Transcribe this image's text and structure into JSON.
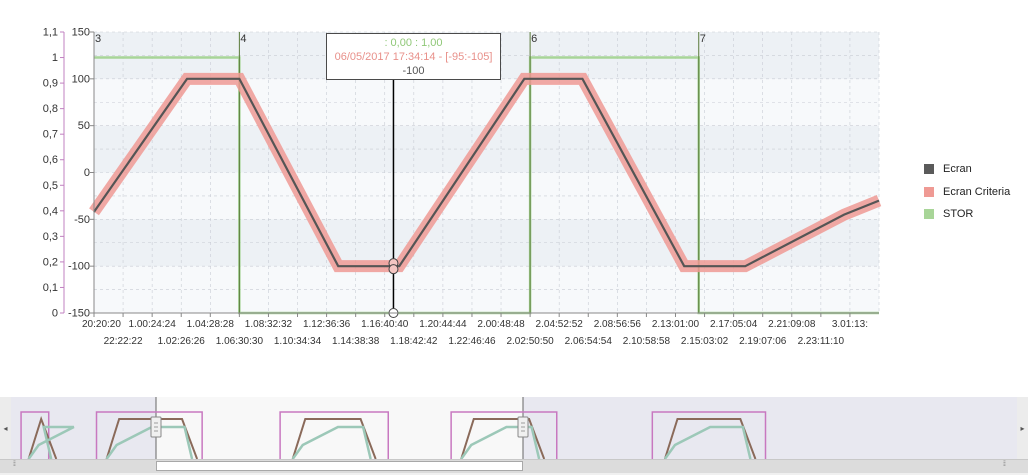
{
  "chart_data": {
    "type": "line",
    "left_axis_ticks": [
      "0",
      "0,1",
      "0,2",
      "0,3",
      "0,4",
      "0,5",
      "0,6",
      "0,7",
      "0,8",
      "0,9",
      "1",
      "1,1"
    ],
    "left_axis_range": [
      0,
      1.1
    ],
    "right_axis_ticks": [
      "-150",
      "-100",
      "-50",
      "0",
      "50",
      "100",
      "150"
    ],
    "right_axis_range": [
      -150,
      150
    ],
    "x_labels_row1": [
      "20:20:20",
      "1.00:24:24",
      "1.04:28:28",
      "1.08:32:32",
      "1.12:36:36",
      "1.16:40:40",
      "1.20:44:44",
      "2.00:48:48",
      "2.04:52:52",
      "2.08:56:56",
      "2.13:01:00",
      "2.17:05:04",
      "2.21:09:08",
      "3.01:13:"
    ],
    "x_labels_row2": [
      "22:22:22",
      "1.02:26:26",
      "1.06:30:30",
      "1.10:34:34",
      "1.14:38:38",
      "1.18:42:42",
      "1.22:46:46",
      "2.02:50:50",
      "2.06:54:54",
      "2.10:58:58",
      "2.15:03:02",
      "2.19:07:06",
      "2.23:11:10"
    ],
    "x_range": [
      0,
      27
    ],
    "series": [
      {
        "name": "Ecran",
        "color": "#555555",
        "axis": "right",
        "x": [
          0,
          3.2,
          5.0,
          8.4,
          10.5,
          14.8,
          16.8,
          20.3,
          22.4,
          25.8,
          27
        ],
        "values": [
          -42,
          100,
          100,
          -100,
          -100,
          100,
          100,
          -100,
          -100,
          -45,
          -30
        ]
      },
      {
        "name": "Ecran Criteria",
        "color": "#ef9a94",
        "axis": "right",
        "x": [
          0,
          3.2,
          5.0,
          8.4,
          10.5,
          14.8,
          16.8,
          20.3,
          22.4,
          25.8,
          27
        ],
        "values": [
          -42,
          100,
          100,
          -100,
          -100,
          100,
          100,
          -100,
          -100,
          -45,
          -30
        ]
      },
      {
        "name": "STOR",
        "color": "#a8d598",
        "axis": "left",
        "x": [
          0,
          5.0,
          5.0,
          15.0,
          15.0,
          20.8,
          20.8,
          27
        ],
        "values": [
          1,
          1,
          0,
          0,
          1,
          1,
          0,
          0
        ]
      }
    ],
    "markers": [
      {
        "label": "3",
        "x": 0
      },
      {
        "label": "4",
        "x": 5.0
      },
      {
        "label": "6",
        "x": 15.0
      },
      {
        "label": "7",
        "x": 20.8
      }
    ],
    "cursor": {
      "x": 10.3
    },
    "tooltip": {
      "line1": ": 0,00 : 1,00",
      "line2": "06/05/2017 17:34:14 - [-95:-105]",
      "line3": "-100"
    },
    "grid": true,
    "legend_position": "right"
  },
  "colors": {
    "left_axis": "#c080c0",
    "grid": "#c8ccd4",
    "band": "#edf1f5",
    "marker_line": "#5a7a3a",
    "tooltip_line1": "#90c878",
    "tooltip_line2": "#e8908a",
    "tooltip_line3": "#555555"
  },
  "navigator": {
    "left_arrow": "◂",
    "right_arrow": "▸",
    "grip": "⁞⁞"
  }
}
